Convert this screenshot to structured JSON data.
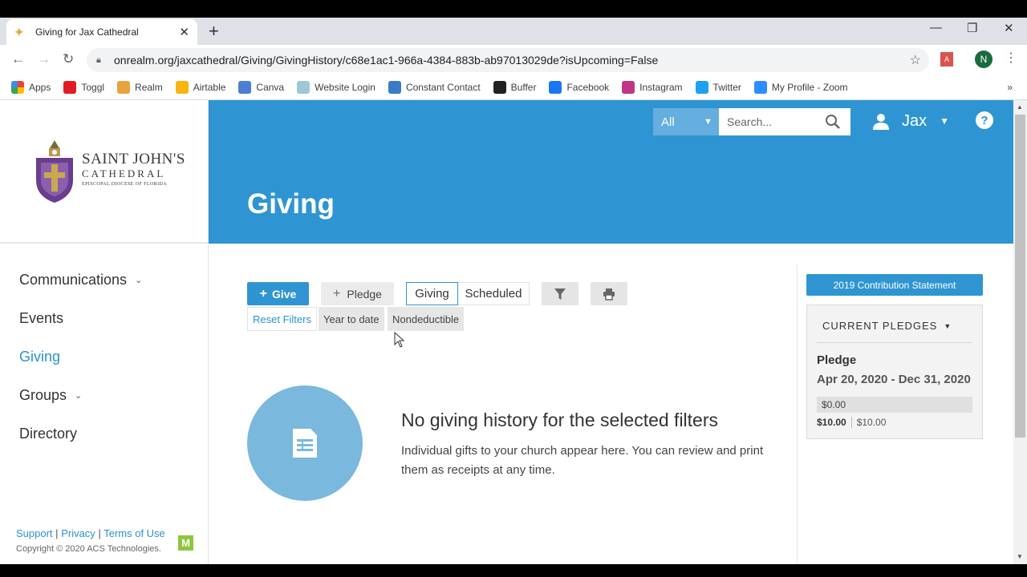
{
  "browser": {
    "tab_title": "Giving for Jax Cathedral",
    "url": "onrealm.org/jaxcathedral/Giving/GivingHistory/c68e1ac1-966a-4384-883b-ab97013029de?isUpcoming=False",
    "profile_initial": "N",
    "bookmarks": [
      {
        "label": "Apps",
        "icon": "apps-grid-icon"
      },
      {
        "label": "Toggl",
        "icon": "toggl-icon",
        "color": "#e01b22"
      },
      {
        "label": "Realm",
        "icon": "realm-icon",
        "color": "#e8a33a"
      },
      {
        "label": "Airtable",
        "icon": "airtable-icon",
        "color": "#f6b60f"
      },
      {
        "label": "Canva",
        "icon": "canva-icon",
        "color": "#4a7fd4"
      },
      {
        "label": "Website Login",
        "icon": "website-icon",
        "color": "#9ec7d8"
      },
      {
        "label": "Constant Contact",
        "icon": "constant-contact-icon",
        "color": "#3b7ac9"
      },
      {
        "label": "Buffer",
        "icon": "buffer-icon",
        "color": "#222222"
      },
      {
        "label": "Facebook",
        "icon": "facebook-icon",
        "color": "#1877f2"
      },
      {
        "label": "Instagram",
        "icon": "instagram-icon",
        "color": "#c13584"
      },
      {
        "label": "Twitter",
        "icon": "twitter-icon",
        "color": "#1da1f2"
      },
      {
        "label": "My Profile - Zoom",
        "icon": "zoom-icon",
        "color": "#2d8cff"
      }
    ]
  },
  "brand": {
    "line1": "SAINT JOHN'S",
    "line2": "CATHEDRAL",
    "line3": "EPISCOPAL DIOCESE OF FLORIDA",
    "accent": "#2f95d2"
  },
  "sidebar": {
    "items": [
      {
        "label": "Communications",
        "has_dropdown": true
      },
      {
        "label": "Events",
        "has_dropdown": false
      },
      {
        "label": "Giving",
        "has_dropdown": false,
        "active": true
      },
      {
        "label": "Groups",
        "has_dropdown": true
      },
      {
        "label": "Directory",
        "has_dropdown": false
      }
    ],
    "footer": {
      "support": "Support",
      "privacy": "Privacy",
      "terms": "Terms of Use",
      "sep": "|",
      "copyright": "Copyright © 2020 ACS Technologies."
    }
  },
  "header": {
    "scope_select": "All",
    "search_placeholder": "Search...",
    "user_name": "Jax",
    "help": "?",
    "page_title": "Giving"
  },
  "toolbar": {
    "give_label": "Give",
    "pledge_label": "Pledge",
    "segment": [
      "Giving",
      "Scheduled"
    ],
    "segment_selected": "Giving",
    "filters": {
      "reset": "Reset Filters",
      "year": "Year to date",
      "deductible": "Nondeductible"
    }
  },
  "empty_state": {
    "title": "No giving history for the selected filters",
    "description": "Individual gifts to your church appear here. You can review and print them as receipts at any time."
  },
  "right_panel": {
    "statement_button": "2019 Contribution Statement",
    "pledges_header": "CURRENT PLEDGES",
    "pledge": {
      "name": "Pledge",
      "dates": "Apr 20, 2020 - Dec 31, 2020",
      "given": "$0.00",
      "goal": "$10.00",
      "total": "$10.00",
      "progress_fraction": 0.0
    }
  }
}
